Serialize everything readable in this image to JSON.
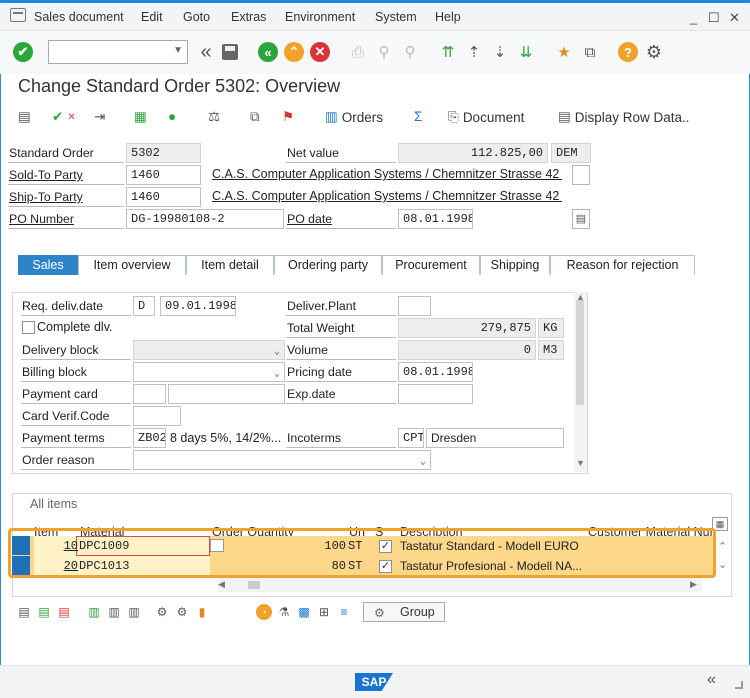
{
  "menu": {
    "items": [
      "Sales document",
      "Edit",
      "Goto",
      "Extras",
      "Environment",
      "System",
      "Help"
    ]
  },
  "window": {
    "minimize": "_",
    "maximize": "☐",
    "close": "✕"
  },
  "toolbar": {
    "command_field": ""
  },
  "page_title": "Change Standard Order 5302: Overview",
  "app_toolbar": {
    "orders": "Orders",
    "document": "Document",
    "display_row_data": "Display Row Data.."
  },
  "header": {
    "standard_order_label": "Standard Order",
    "standard_order_value": "5302",
    "net_value_label": "Net value",
    "net_value_value": "112.825,00",
    "currency": "DEM",
    "sold_to_label": "Sold-To Party",
    "sold_to_value": "1460",
    "sold_to_name": "C.A.S. Computer Application Systems / Chemnitzer Strasse 42 ...",
    "ship_to_label": "Ship-To Party",
    "ship_to_value": "1460",
    "ship_to_name": "C.A.S. Computer Application Systems / Chemnitzer Strasse 42 ...",
    "po_number_label": "PO Number",
    "po_number_value": "DG-19980108-2",
    "po_date_label": "PO date",
    "po_date_value": "08.01.1998"
  },
  "tabs": [
    "Sales",
    "Item overview",
    "Item detail",
    "Ordering party",
    "Procurement",
    "Shipping",
    "Reason for rejection"
  ],
  "sales": {
    "req_deliv_date_label": "Req. deliv.date",
    "req_deliv_date_type": "D",
    "req_deliv_date_value": "09.01.1998",
    "deliver_plant_label": "Deliver.Plant",
    "deliver_plant_value": "",
    "complete_dlv_label": "Complete dlv.",
    "total_weight_label": "Total Weight",
    "total_weight_value": "279,875",
    "total_weight_unit": "KG",
    "delivery_block_label": "Delivery block",
    "volume_label": "Volume",
    "volume_value": "0",
    "volume_unit": "M3",
    "billing_block_label": "Billing block",
    "pricing_date_label": "Pricing date",
    "pricing_date_value": "08.01.1998",
    "payment_card_label": "Payment card",
    "exp_date_label": "Exp.date",
    "card_verif_label": "Card Verif.Code",
    "payment_terms_label": "Payment terms",
    "payment_terms_code": "ZB02",
    "payment_terms_text": "8 days 5%, 14/2%...",
    "incoterms_label": "Incoterms",
    "incoterms_code": "CPT",
    "incoterms_place": "Dresden",
    "order_reason_label": "Order reason"
  },
  "items": {
    "title": "All items",
    "columns": [
      "Item",
      "Material",
      "Order Quantity",
      "Un",
      "S",
      "Description",
      "Customer Material Num"
    ],
    "rows": [
      {
        "item": "10",
        "material": "DPC1009",
        "quantity": "100",
        "unit": "ST",
        "description": "Tastatur Standard - Modell EURO"
      },
      {
        "item": "20",
        "material": "DPC1013",
        "quantity": "80",
        "unit": "ST",
        "description": "Tastatur Profesional - Modell NA..."
      }
    ]
  },
  "bottom": {
    "group_label": "Group"
  },
  "footer": {
    "logo": "SAP"
  }
}
